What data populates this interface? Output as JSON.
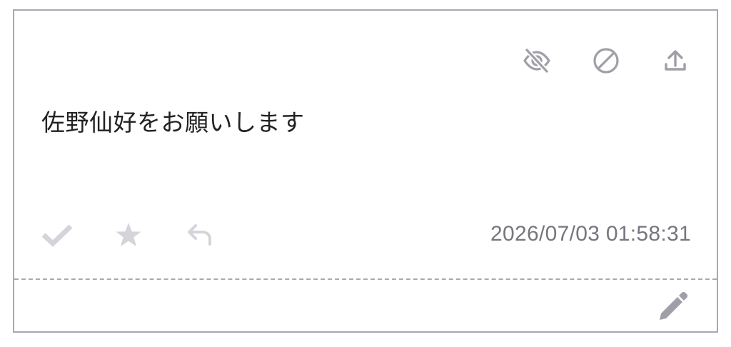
{
  "card": {
    "message": "佐野仙好をお願いします",
    "timestamp": "2026/07/03 01:58:31"
  },
  "icons": {
    "top": [
      "eye-off-icon",
      "block-icon",
      "upload-icon"
    ],
    "bottom": [
      "check-icon",
      "star-icon",
      "reply-icon"
    ],
    "footer": [
      "pencil-icon"
    ]
  },
  "colors": {
    "border": "#a9a8b2",
    "icon_gray": "#a09fa8",
    "icon_light": "#d5d4da",
    "text": "#222222",
    "timestamp": "#77767e"
  }
}
